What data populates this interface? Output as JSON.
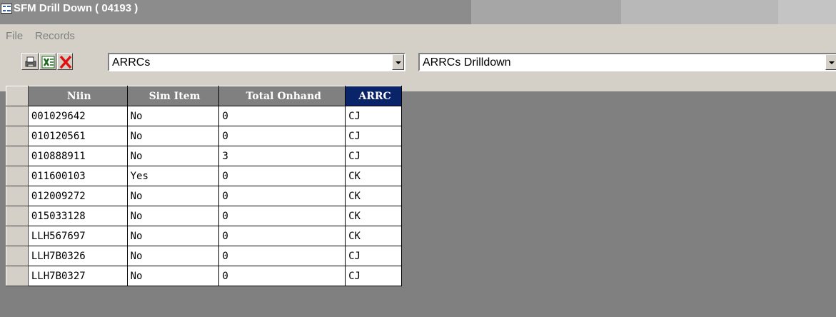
{
  "window": {
    "title": "SFM Drill Down ( 04193 )",
    "app_icon": "window-form-icon"
  },
  "menu": {
    "items": [
      "File",
      "Records"
    ]
  },
  "toolbar": {
    "buttons": [
      "print-icon",
      "excel-export-icon",
      "delete-icon"
    ],
    "combo_left_value": "ARRCs",
    "combo_right_value": "ARRCs Drilldown"
  },
  "grid": {
    "columns": [
      "Niin",
      "Sim Item",
      "Total Onhand",
      "ARRC"
    ],
    "rows": [
      [
        "001029642",
        "No",
        "0",
        "CJ"
      ],
      [
        "010120561",
        "No",
        "0",
        "CJ"
      ],
      [
        "010888911",
        "No",
        "3",
        "CJ"
      ],
      [
        "011600103",
        "Yes",
        "0",
        "CK"
      ],
      [
        "012009272",
        "No",
        "0",
        "CK"
      ],
      [
        "015033128",
        "No",
        "0",
        "CK"
      ],
      [
        "LLH567697",
        "No",
        "0",
        "CK"
      ],
      [
        "LLH7B0326",
        "No",
        "0",
        "CJ"
      ],
      [
        "LLH7B0327",
        "No",
        "0",
        "CJ"
      ]
    ]
  },
  "colors": {
    "background": "#808080",
    "chrome": "#d4d0c8",
    "active_header": "#0a246a"
  }
}
